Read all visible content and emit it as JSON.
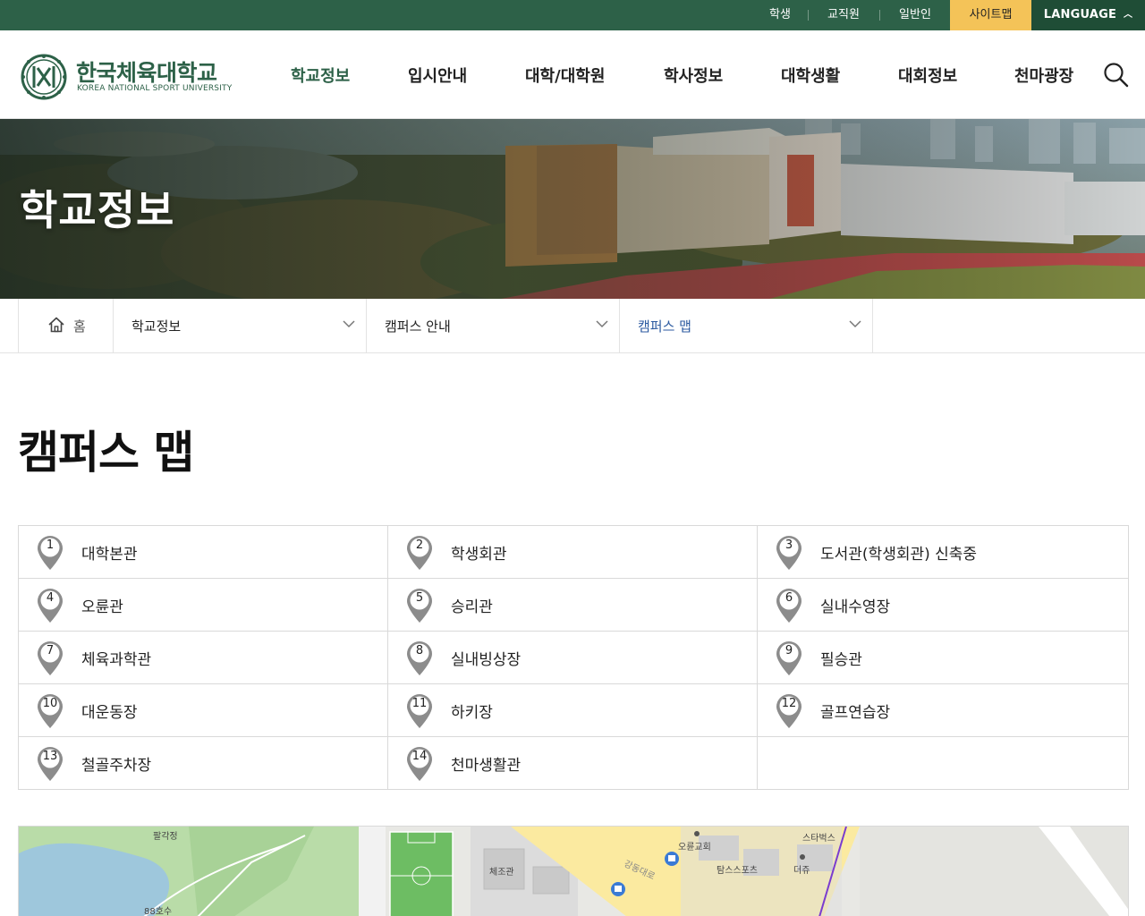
{
  "util": {
    "student": "학생",
    "staff": "교직원",
    "public": "일반인",
    "sitemap": "사이트맵",
    "language": "LANGUAGE",
    "accent_color": "#f4c358",
    "bar_color": "#2d6148"
  },
  "logo": {
    "name_kr": "한국체육대학교",
    "name_en": "KOREA NATIONAL SPORT UNIVERSITY",
    "emblem_letters": "KNSU"
  },
  "gnb": {
    "items": [
      "학교정보",
      "입시안내",
      "대학/대학원",
      "학사정보",
      "대학생활",
      "대회정보",
      "천마광장"
    ],
    "active_index": 0,
    "search_icon": "search-icon"
  },
  "hero": {
    "title": "학교정보"
  },
  "breadcrumb": {
    "home": "홈",
    "level1": "학교정보",
    "level2": "캠퍼스 안내",
    "level3": "캠퍼스 맵"
  },
  "page": {
    "title": "캠퍼스 맵"
  },
  "buildings": [
    {
      "num": "1",
      "name": "대학본관"
    },
    {
      "num": "2",
      "name": "학생회관"
    },
    {
      "num": "3",
      "name": "도서관(학생회관) 신축중"
    },
    {
      "num": "4",
      "name": "오륜관"
    },
    {
      "num": "5",
      "name": "승리관"
    },
    {
      "num": "6",
      "name": "실내수영장"
    },
    {
      "num": "7",
      "name": "체육과학관"
    },
    {
      "num": "8",
      "name": "실내빙상장"
    },
    {
      "num": "9",
      "name": "필승관"
    },
    {
      "num": "10",
      "name": "대운동장"
    },
    {
      "num": "11",
      "name": "하키장"
    },
    {
      "num": "12",
      "name": "골프연습장"
    },
    {
      "num": "13",
      "name": "철골주차장"
    },
    {
      "num": "14",
      "name": "천마생활관"
    }
  ],
  "map": {
    "labels": {
      "palgakjeong": "팔각정",
      "88hosu": "88호수",
      "chejogwan": "체조관",
      "oryun_church": "오륜교회",
      "tams_sports": "탐스스포츠",
      "starbucks": "스타벅스",
      "dejue": "더쥬",
      "road": "강동대로"
    }
  }
}
